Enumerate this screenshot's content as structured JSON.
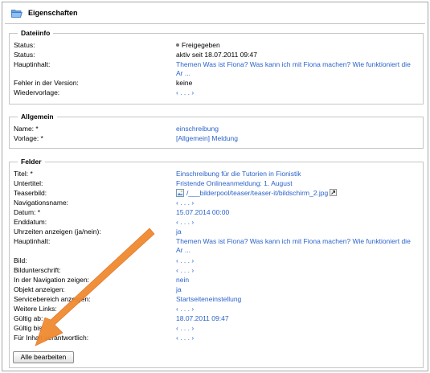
{
  "header": {
    "title": "Eigenschaften"
  },
  "dateiinfo": {
    "legend": "Dateiinfo",
    "rows": [
      {
        "label": "Status:",
        "value": "Freigegeben"
      },
      {
        "label": "Status:",
        "value": "aktiv seit 18.07.2011 09:47"
      },
      {
        "label": "Hauptinhalt:",
        "value": "Themen Was ist Fiona? Was kann ich mit Fiona machen? Wie funktioniert die Ar ..."
      },
      {
        "label": "Fehler in der Version:",
        "value": "keine"
      },
      {
        "label": "Wiedervorlage:",
        "value": "‹ . . . ›"
      }
    ]
  },
  "allgemein": {
    "legend": "Allgemein",
    "rows": [
      {
        "label": "Name: *",
        "value": "einschreibung"
      },
      {
        "label": "Vorlage: *",
        "value": "[Allgemein] Meldung"
      }
    ]
  },
  "felder": {
    "legend": "Felder",
    "rows": [
      {
        "label": "Titel: *",
        "value": "Einschreibung für die Tutorien in Fionistik"
      },
      {
        "label": "Untertitel:",
        "value": "Fristende Onlineanmeldung: 1. August"
      },
      {
        "label": "Teaserbild:",
        "value": "/___bilderpool/teaser/teaser-it/bildschirm_2.jpg"
      },
      {
        "label": "Navigationsname:",
        "value": "‹ . . . ›"
      },
      {
        "label": "Datum: *",
        "value": "15.07.2014 00:00"
      },
      {
        "label": "Enddatum:",
        "value": "‹ . . . ›"
      },
      {
        "label": "Uhrzeiten anzeigen (ja/nein):",
        "value": "ja"
      },
      {
        "label": "Hauptinhalt:",
        "value": "Themen Was ist Fiona? Was kann ich mit Fiona machen? Wie funktioniert die Ar ..."
      },
      {
        "label": "Bild:",
        "value": "‹ . . . ›"
      },
      {
        "label": "Bildunterschrift:",
        "value": "‹ . . . ›"
      },
      {
        "label": "In der Navigation zeigen:",
        "value": "nein"
      },
      {
        "label": "Objekt anzeigen:",
        "value": "ja"
      },
      {
        "label": "Servicebereich anzeigen:",
        "value": "Startseiteneinstellung"
      },
      {
        "label": "Weitere Links:",
        "value": "‹ . . . ›"
      },
      {
        "label": "Gültig ab:",
        "value": "18.07.2011 09:47"
      },
      {
        "label": "Gültig bis:",
        "value": "‹ . . . ›"
      },
      {
        "label": "Für Inhalt verantwortlich:",
        "value": "‹ . . . ›"
      }
    ]
  },
  "actions": {
    "edit_all_label": "Alle bearbeiten"
  },
  "colors": {
    "link": "#2b63c9",
    "arrow": "#f28a2e",
    "border": "#c6c6c6"
  },
  "icons": [
    "folder-open-icon",
    "status-dot-icon",
    "image-file-icon",
    "external-link-icon",
    "annotation-arrow"
  ]
}
